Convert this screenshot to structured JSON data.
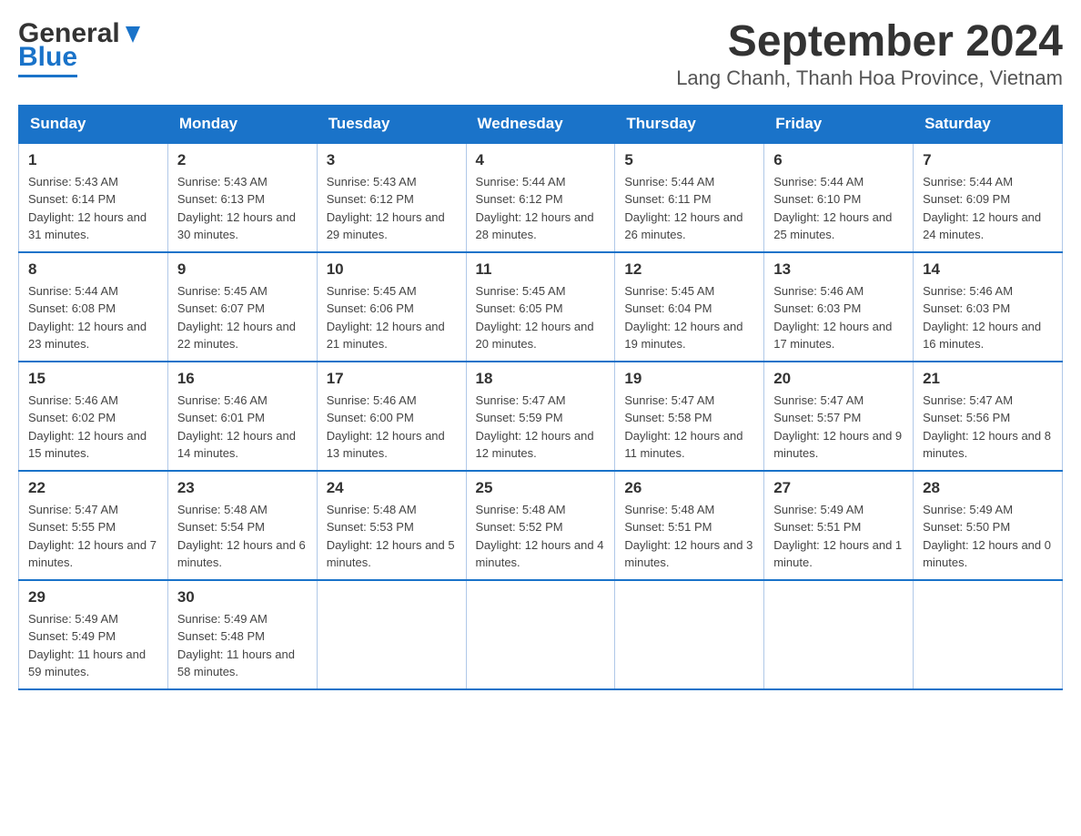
{
  "logo": {
    "text_general": "General",
    "text_blue": "Blue"
  },
  "title": "September 2024",
  "subtitle": "Lang Chanh, Thanh Hoa Province, Vietnam",
  "days_of_week": [
    "Sunday",
    "Monday",
    "Tuesday",
    "Wednesday",
    "Thursday",
    "Friday",
    "Saturday"
  ],
  "weeks": [
    [
      {
        "day": "1",
        "sunrise": "5:43 AM",
        "sunset": "6:14 PM",
        "daylight": "12 hours and 31 minutes."
      },
      {
        "day": "2",
        "sunrise": "5:43 AM",
        "sunset": "6:13 PM",
        "daylight": "12 hours and 30 minutes."
      },
      {
        "day": "3",
        "sunrise": "5:43 AM",
        "sunset": "6:12 PM",
        "daylight": "12 hours and 29 minutes."
      },
      {
        "day": "4",
        "sunrise": "5:44 AM",
        "sunset": "6:12 PM",
        "daylight": "12 hours and 28 minutes."
      },
      {
        "day": "5",
        "sunrise": "5:44 AM",
        "sunset": "6:11 PM",
        "daylight": "12 hours and 26 minutes."
      },
      {
        "day": "6",
        "sunrise": "5:44 AM",
        "sunset": "6:10 PM",
        "daylight": "12 hours and 25 minutes."
      },
      {
        "day": "7",
        "sunrise": "5:44 AM",
        "sunset": "6:09 PM",
        "daylight": "12 hours and 24 minutes."
      }
    ],
    [
      {
        "day": "8",
        "sunrise": "5:44 AM",
        "sunset": "6:08 PM",
        "daylight": "12 hours and 23 minutes."
      },
      {
        "day": "9",
        "sunrise": "5:45 AM",
        "sunset": "6:07 PM",
        "daylight": "12 hours and 22 minutes."
      },
      {
        "day": "10",
        "sunrise": "5:45 AM",
        "sunset": "6:06 PM",
        "daylight": "12 hours and 21 minutes."
      },
      {
        "day": "11",
        "sunrise": "5:45 AM",
        "sunset": "6:05 PM",
        "daylight": "12 hours and 20 minutes."
      },
      {
        "day": "12",
        "sunrise": "5:45 AM",
        "sunset": "6:04 PM",
        "daylight": "12 hours and 19 minutes."
      },
      {
        "day": "13",
        "sunrise": "5:46 AM",
        "sunset": "6:03 PM",
        "daylight": "12 hours and 17 minutes."
      },
      {
        "day": "14",
        "sunrise": "5:46 AM",
        "sunset": "6:03 PM",
        "daylight": "12 hours and 16 minutes."
      }
    ],
    [
      {
        "day": "15",
        "sunrise": "5:46 AM",
        "sunset": "6:02 PM",
        "daylight": "12 hours and 15 minutes."
      },
      {
        "day": "16",
        "sunrise": "5:46 AM",
        "sunset": "6:01 PM",
        "daylight": "12 hours and 14 minutes."
      },
      {
        "day": "17",
        "sunrise": "5:46 AM",
        "sunset": "6:00 PM",
        "daylight": "12 hours and 13 minutes."
      },
      {
        "day": "18",
        "sunrise": "5:47 AM",
        "sunset": "5:59 PM",
        "daylight": "12 hours and 12 minutes."
      },
      {
        "day": "19",
        "sunrise": "5:47 AM",
        "sunset": "5:58 PM",
        "daylight": "12 hours and 11 minutes."
      },
      {
        "day": "20",
        "sunrise": "5:47 AM",
        "sunset": "5:57 PM",
        "daylight": "12 hours and 9 minutes."
      },
      {
        "day": "21",
        "sunrise": "5:47 AM",
        "sunset": "5:56 PM",
        "daylight": "12 hours and 8 minutes."
      }
    ],
    [
      {
        "day": "22",
        "sunrise": "5:47 AM",
        "sunset": "5:55 PM",
        "daylight": "12 hours and 7 minutes."
      },
      {
        "day": "23",
        "sunrise": "5:48 AM",
        "sunset": "5:54 PM",
        "daylight": "12 hours and 6 minutes."
      },
      {
        "day": "24",
        "sunrise": "5:48 AM",
        "sunset": "5:53 PM",
        "daylight": "12 hours and 5 minutes."
      },
      {
        "day": "25",
        "sunrise": "5:48 AM",
        "sunset": "5:52 PM",
        "daylight": "12 hours and 4 minutes."
      },
      {
        "day": "26",
        "sunrise": "5:48 AM",
        "sunset": "5:51 PM",
        "daylight": "12 hours and 3 minutes."
      },
      {
        "day": "27",
        "sunrise": "5:49 AM",
        "sunset": "5:51 PM",
        "daylight": "12 hours and 1 minute."
      },
      {
        "day": "28",
        "sunrise": "5:49 AM",
        "sunset": "5:50 PM",
        "daylight": "12 hours and 0 minutes."
      }
    ],
    [
      {
        "day": "29",
        "sunrise": "5:49 AM",
        "sunset": "5:49 PM",
        "daylight": "11 hours and 59 minutes."
      },
      {
        "day": "30",
        "sunrise": "5:49 AM",
        "sunset": "5:48 PM",
        "daylight": "11 hours and 58 minutes."
      },
      null,
      null,
      null,
      null,
      null
    ]
  ]
}
